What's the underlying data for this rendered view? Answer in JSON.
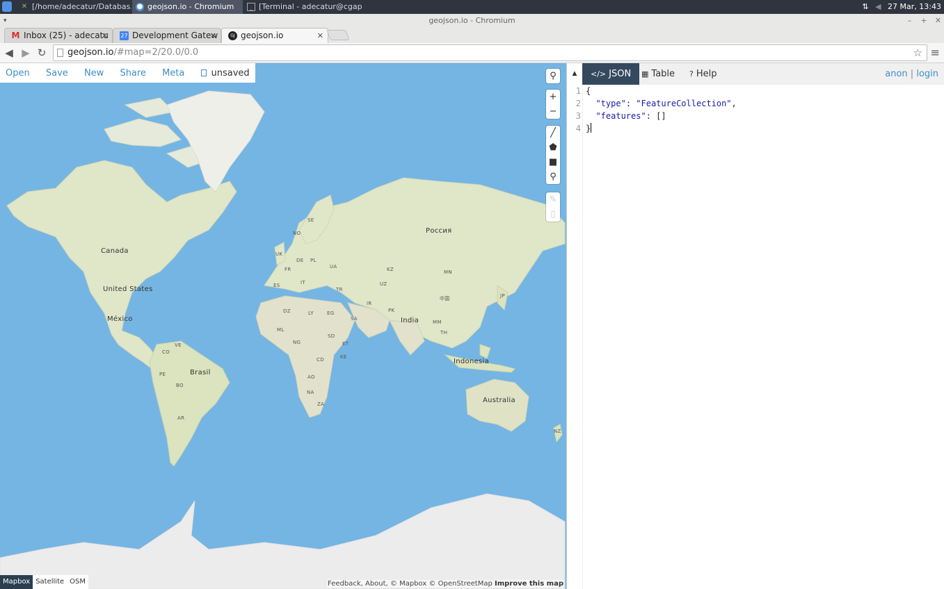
{
  "taskbar": {
    "tasks": [
      {
        "label": "[/home/adecatur/Databas...",
        "icon": "file-manager-icon"
      },
      {
        "label": "geojson.io - Chromium",
        "icon": "chromium-icon"
      },
      {
        "label": "[Terminal - adecatur@cgap...",
        "icon": "terminal-icon"
      }
    ],
    "clock": "27 Mar, 13:43"
  },
  "window": {
    "title": "geojson.io - Chromium"
  },
  "tabs": [
    {
      "label": "Inbox (25) - adecatu",
      "icon": "gmail-icon"
    },
    {
      "label": "Development Gatew",
      "icon": "calendar-icon",
      "icon_text": "27"
    },
    {
      "label": "geojson.io",
      "icon": "geojson-icon",
      "icon_text": "GJ"
    }
  ],
  "address": {
    "host": "geojson.io",
    "path": "/#map=2/20.0/0.0"
  },
  "map_menu": {
    "open": "Open",
    "save": "Save",
    "new": "New",
    "share": "Share",
    "meta": "Meta",
    "status": "unsaved"
  },
  "map_labels": {
    "canada": "Canada",
    "us": "United States",
    "mexico": "México",
    "brasil": "Brasil",
    "russia": "Россия",
    "india": "India",
    "indonesia": "Indonesia",
    "australia": "Australia",
    "china": "中国",
    "ve": "VE",
    "co": "CO",
    "pe": "PE",
    "bo": "BO",
    "ar": "AR",
    "no": "NO",
    "se": "SE",
    "uk": "UK",
    "de": "DE",
    "pl": "PL",
    "ua": "UA",
    "fr": "FR",
    "es": "ES",
    "it": "IT",
    "tr": "TR",
    "kz": "KZ",
    "uz": "UZ",
    "mn": "MN",
    "ir": "IR",
    "pk": "PK",
    "dz": "DZ",
    "ly": "LY",
    "eg": "EG",
    "sa": "SA",
    "ml": "ML",
    "ng": "NG",
    "sd": "SD",
    "et": "ET",
    "cd": "CD",
    "ke": "KE",
    "ao": "AO",
    "na": "NA",
    "za": "ZA",
    "mm": "MM",
    "th": "TH",
    "jp": "JP",
    "nz": "NZ"
  },
  "layers": {
    "mapbox": "Mapbox",
    "satellite": "Satellite",
    "osm": "OSM",
    "selected": "Mapbox"
  },
  "attribution": {
    "text": "Feedback, About, © Mapbox © OpenStreetMap",
    "improve": "Improve this map"
  },
  "panel": {
    "tabs": {
      "json": "JSON",
      "table": "Table",
      "help": "Help"
    },
    "active_tab": "JSON",
    "auth": {
      "anon": "anon",
      "sep": "|",
      "login": "login"
    },
    "line_numbers": [
      "1",
      "2",
      "3",
      "4"
    ],
    "code": {
      "l1": "{",
      "type_key": "\"type\"",
      "type_val": "\"FeatureCollection\"",
      "features_key": "\"features\"",
      "features_val": "[]",
      "l4": "}"
    }
  },
  "colors": {
    "ocean": "#74b5e3",
    "land": "#dfe6c7",
    "accent": "#3e8ec7",
    "active_tab": "#34495e",
    "ice": "#ececec"
  }
}
